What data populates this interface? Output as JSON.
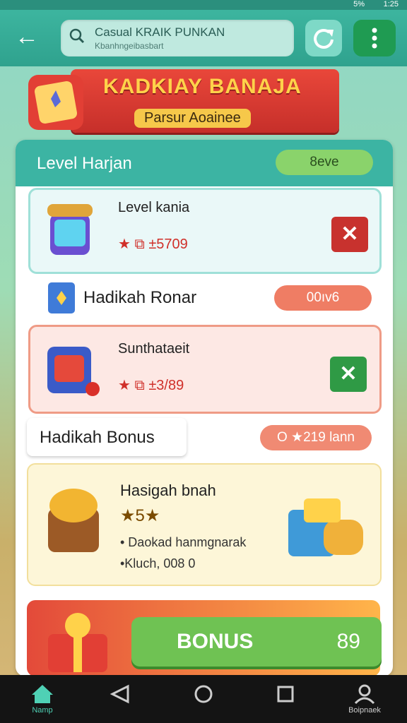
{
  "statusbar": {
    "battery": "5%",
    "time": "1:25"
  },
  "header": {
    "search": {
      "title": "Casual KRAIK PUNKAN",
      "subtitle": "Kbanhngeibasbart"
    }
  },
  "banner": {
    "title": "KADKIAY BANAJA",
    "subtitle": "Parsur Aoainee"
  },
  "panel": {
    "header_title": "Level Harjan",
    "header_button": "8eve",
    "card1": {
      "title": "Level kania",
      "stats": "★ ⧉ ±5709"
    },
    "row2": {
      "title": "Hadikah Ronar",
      "button": "00ıv6"
    },
    "card2": {
      "title": "Sunthataeit",
      "stats": "★ ⧉ ±3/89"
    },
    "bonus_tab": "Hadikah Bonus",
    "bonus_pill": "O ★219 lann",
    "card3": {
      "title": "Hasigah bnah",
      "stars": "★5★",
      "line1": "• Daokad hanmgnarak",
      "line2": "•Kluch, 008 0"
    },
    "bonus_button": {
      "label": "BONUS",
      "value": "89"
    }
  },
  "navbar": {
    "items": [
      {
        "label": "Namp"
      },
      {
        "label": ""
      },
      {
        "label": ""
      },
      {
        "label": ""
      },
      {
        "label": "Boipnaek"
      }
    ]
  },
  "colors": {
    "primary": "#3cb4a3",
    "accent_red": "#c8322e",
    "accent_green": "#2f9a45"
  }
}
